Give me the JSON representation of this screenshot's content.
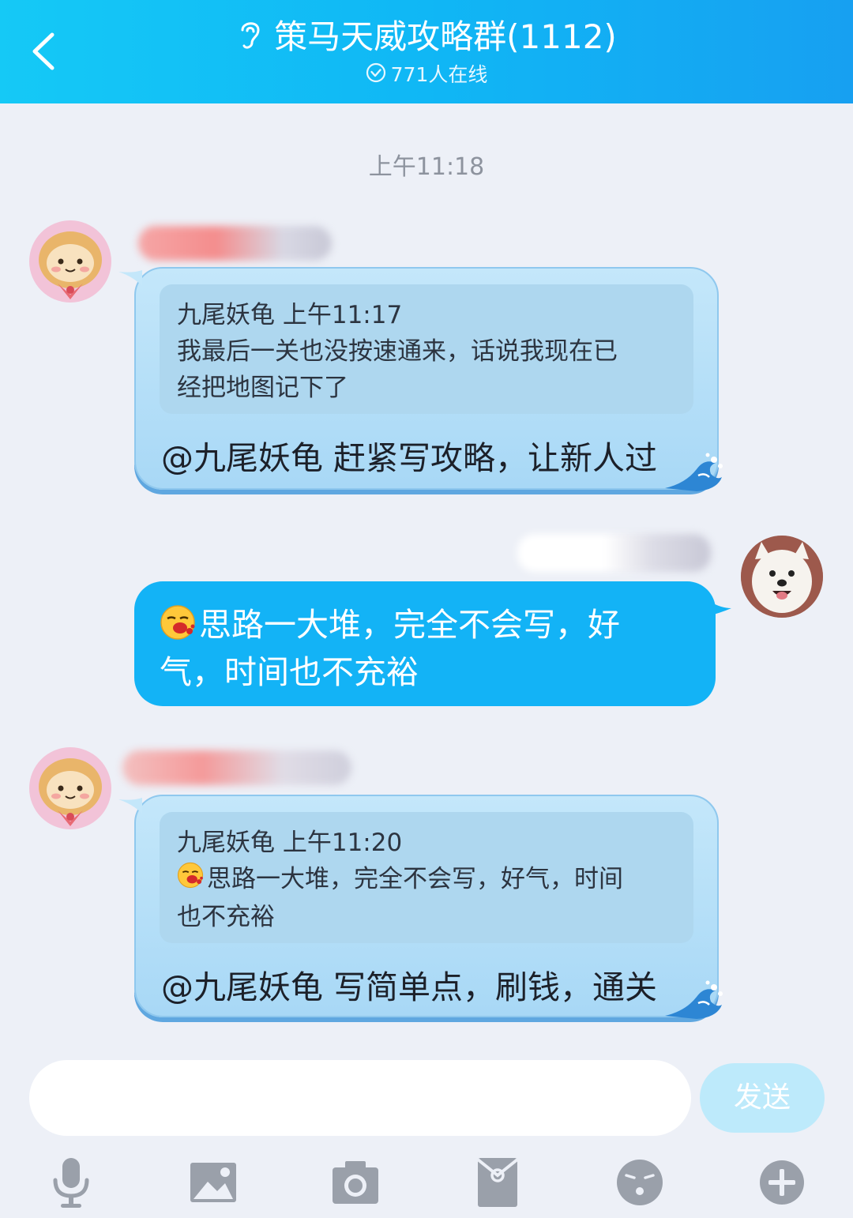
{
  "header": {
    "title": "策马天威攻略群(1112)",
    "online": "771人在线"
  },
  "chat": {
    "timestamp": "上午11:18",
    "messages": [
      {
        "quote_header": "九尾妖龟 上午11:17",
        "quote_line1": "我最后一关也没按速通来，话说我现在已",
        "quote_line2": "经把地图记下了",
        "text": "@九尾妖龟 赶紧写攻略，让新人过"
      },
      {
        "text_line1": "思路一大堆，完全不会写，好",
        "text_line2": "气，时间也不充裕",
        "emoji": "vomit-emoji"
      },
      {
        "quote_header": "九尾妖龟 上午11:20",
        "quote_line1": "思路一大堆，完全不会写，好气，时间",
        "quote_line2": "也不充裕",
        "text": "@九尾妖龟 写简单点，刷钱，通关"
      }
    ]
  },
  "input": {
    "placeholder": "",
    "send_label": "发送"
  },
  "toolbar": [
    "microphone-icon",
    "image-icon",
    "camera-icon",
    "red-packet-icon",
    "emoji-icon",
    "plus-icon"
  ],
  "colors": {
    "header_start": "#15c9f6",
    "header_end": "#17a0f1",
    "out_bubble": "#13b3f6",
    "in_bubble": "#b3defa",
    "background": "#edf0f7",
    "send_button": "#bdeafb",
    "toolbar_icon": "#9aa0aa"
  }
}
